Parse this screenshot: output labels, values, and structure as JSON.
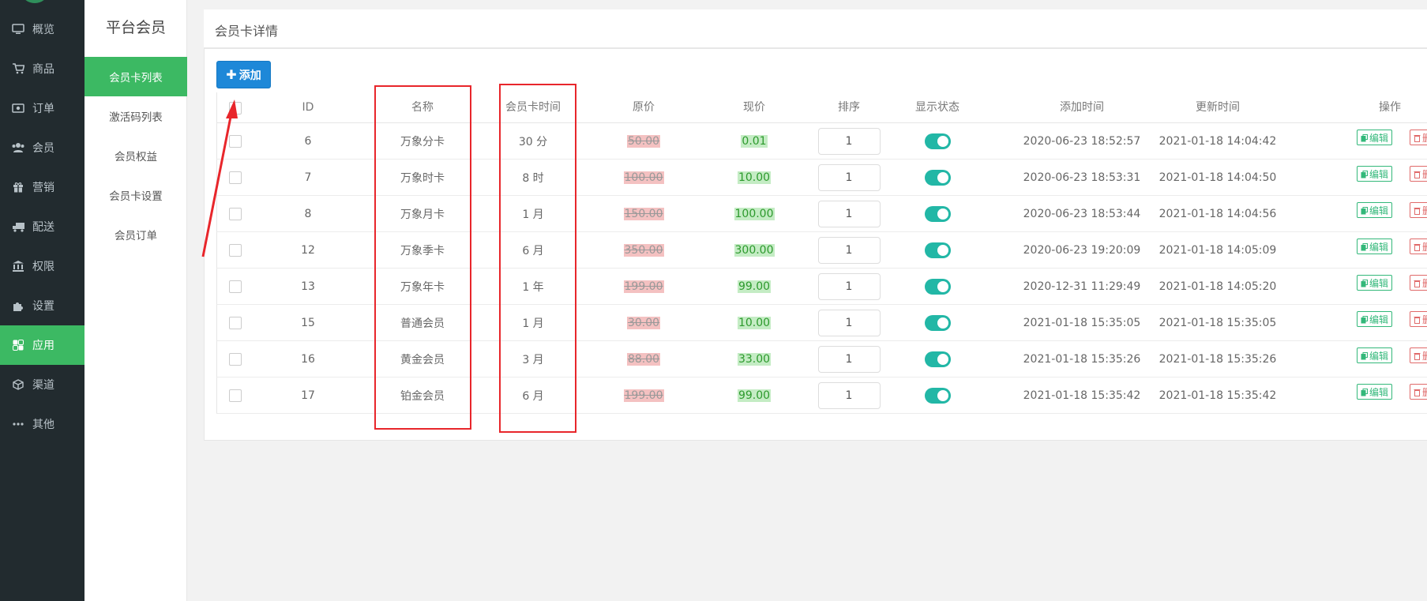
{
  "sidebar": {
    "items": [
      {
        "label": "概览",
        "icon": "monitor-icon"
      },
      {
        "label": "商品",
        "icon": "cart-icon"
      },
      {
        "label": "订单",
        "icon": "money-icon"
      },
      {
        "label": "会员",
        "icon": "users-icon"
      },
      {
        "label": "营销",
        "icon": "gift-icon"
      },
      {
        "label": "配送",
        "icon": "truck-icon"
      },
      {
        "label": "权限",
        "icon": "bank-icon"
      },
      {
        "label": "设置",
        "icon": "puzzle-icon"
      },
      {
        "label": "应用",
        "icon": "apps-icon"
      },
      {
        "label": "渠道",
        "icon": "cube-icon"
      },
      {
        "label": "其他",
        "icon": "more-icon"
      }
    ],
    "active_index": 8
  },
  "submenu": {
    "title": "平台会员",
    "items": [
      "会员卡列表",
      "激活码列表",
      "会员权益",
      "会员卡设置",
      "会员订单"
    ],
    "active_index": 0
  },
  "header": {
    "title": "会员卡详情"
  },
  "toolbar": {
    "add_label": "添加"
  },
  "table": {
    "columns": [
      "ID",
      "名称",
      "会员卡时间",
      "原价",
      "现价",
      "排序",
      "显示状态",
      "添加时间",
      "更新时间",
      "操作"
    ],
    "edit_label": "编辑",
    "delete_label": "删除",
    "rows": [
      {
        "id": "6",
        "name": "万象分卡",
        "duration": "30 分",
        "original_price": "50.00",
        "current_price": "0.01",
        "sort": "1",
        "visible": true,
        "created": "2020-06-23 18:52:57",
        "updated": "2021-01-18 14:04:42"
      },
      {
        "id": "7",
        "name": "万象时卡",
        "duration": "8 时",
        "original_price": "100.00",
        "current_price": "10.00",
        "sort": "1",
        "visible": true,
        "created": "2020-06-23 18:53:31",
        "updated": "2021-01-18 14:04:50"
      },
      {
        "id": "8",
        "name": "万象月卡",
        "duration": "1 月",
        "original_price": "150.00",
        "current_price": "100.00",
        "sort": "1",
        "visible": true,
        "created": "2020-06-23 18:53:44",
        "updated": "2021-01-18 14:04:56"
      },
      {
        "id": "12",
        "name": "万象季卡",
        "duration": "6 月",
        "original_price": "350.00",
        "current_price": "300.00",
        "sort": "1",
        "visible": true,
        "created": "2020-06-23 19:20:09",
        "updated": "2021-01-18 14:05:09"
      },
      {
        "id": "13",
        "name": "万象年卡",
        "duration": "1 年",
        "original_price": "199.00",
        "current_price": "99.00",
        "sort": "1",
        "visible": true,
        "created": "2020-12-31 11:29:49",
        "updated": "2021-01-18 14:05:20"
      },
      {
        "id": "15",
        "name": "普通会员",
        "duration": "1 月",
        "original_price": "30.00",
        "current_price": "10.00",
        "sort": "1",
        "visible": true,
        "created": "2021-01-18 15:35:05",
        "updated": "2021-01-18 15:35:05"
      },
      {
        "id": "16",
        "name": "黄金会员",
        "duration": "3 月",
        "original_price": "88.00",
        "current_price": "33.00",
        "sort": "1",
        "visible": true,
        "created": "2021-01-18 15:35:26",
        "updated": "2021-01-18 15:35:26"
      },
      {
        "id": "17",
        "name": "铂金会员",
        "duration": "6 月",
        "original_price": "199.00",
        "current_price": "99.00",
        "sort": "1",
        "visible": true,
        "created": "2021-01-18 15:35:42",
        "updated": "2021-01-18 15:35:42"
      }
    ]
  },
  "colors": {
    "sidebar_bg": "#222b2f",
    "accent_green": "#3cb963",
    "add_button": "#1e88d8",
    "toggle_on": "#22b7a6",
    "annotation_red": "#e8262b"
  }
}
